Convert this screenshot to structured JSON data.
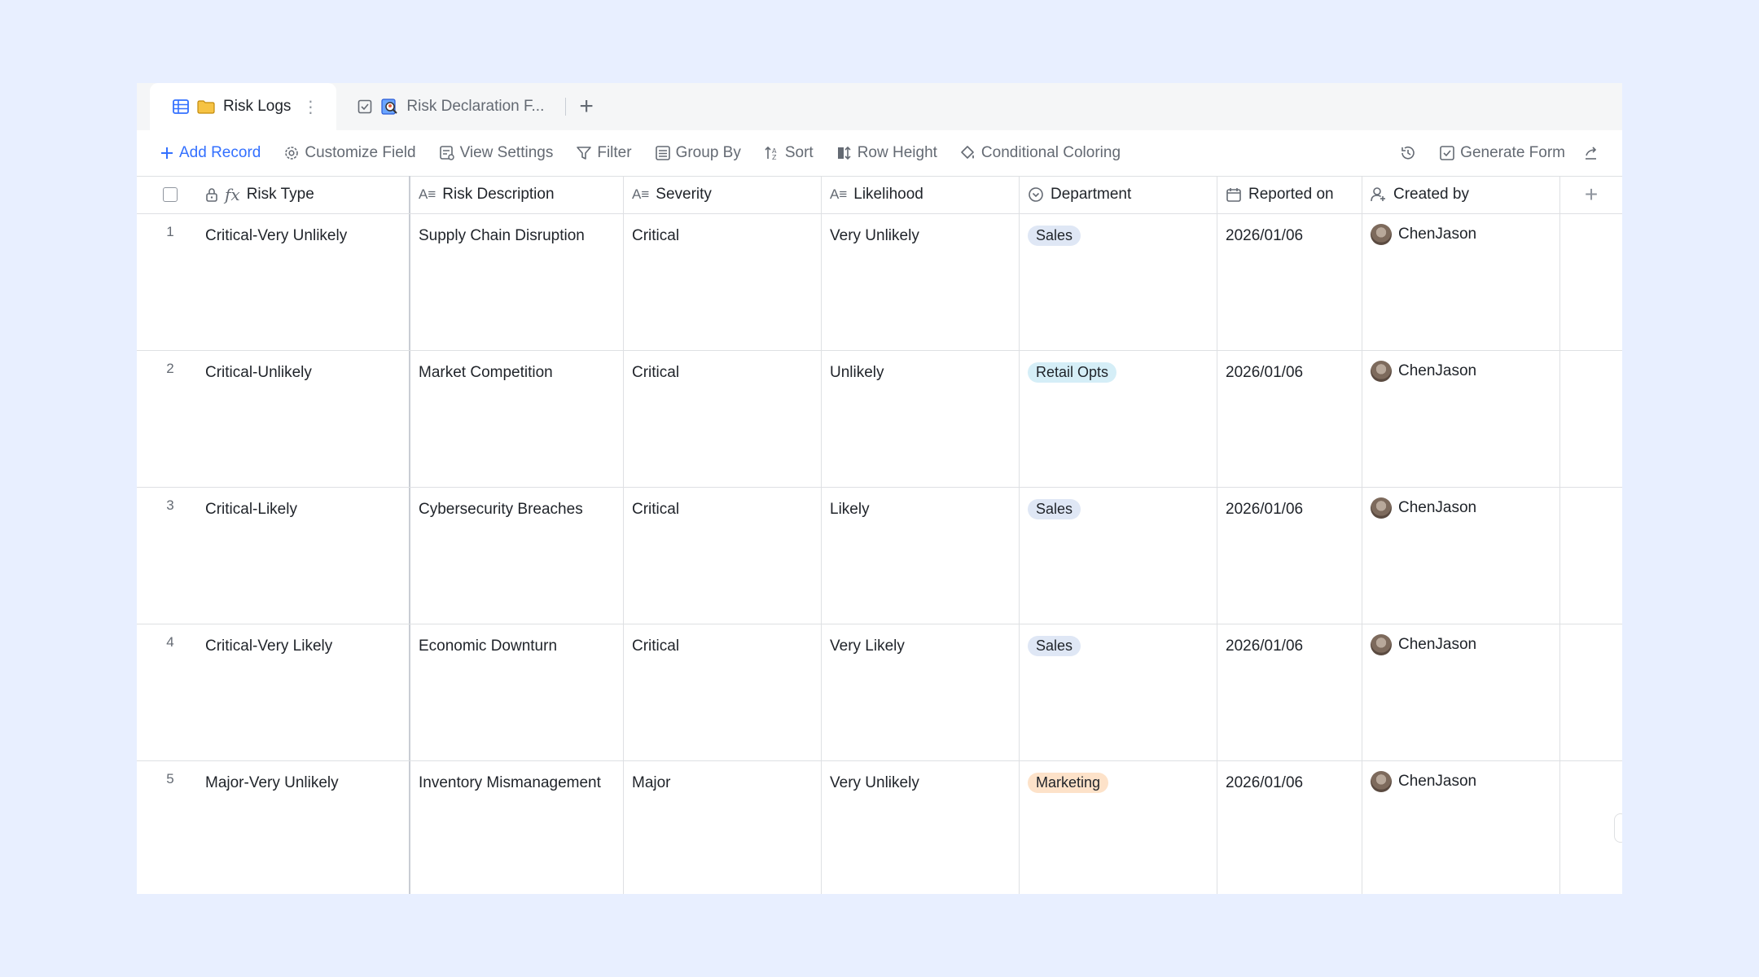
{
  "tabs": [
    {
      "label": "Risk Logs",
      "icon": "folder-icon"
    },
    {
      "label": "Risk Declaration F...",
      "icon": "form-icon"
    }
  ],
  "toolbar": {
    "add_record": "Add Record",
    "customize_field": "Customize Field",
    "view_settings": "View Settings",
    "filter": "Filter",
    "group_by": "Group By",
    "sort": "Sort",
    "row_height": "Row Height",
    "conditional_coloring": "Conditional Coloring",
    "generate_form": "Generate Form"
  },
  "columns": {
    "risk_type": "Risk Type",
    "risk_description": "Risk Description",
    "severity": "Severity",
    "likelihood": "Likelihood",
    "department": "Department",
    "reported_on": "Reported on",
    "created_by": "Created by"
  },
  "rows": [
    {
      "index": "1",
      "risk_type": "Critical-Very Unlikely",
      "risk_description": "Supply Chain Disruption",
      "severity": "Critical",
      "likelihood": "Very Unlikely",
      "department": "Sales",
      "reported_on": "2026/01/06",
      "created_by": "ChenJason"
    },
    {
      "index": "2",
      "risk_type": "Critical-Unlikely",
      "risk_description": "Market Competition",
      "severity": "Critical",
      "likelihood": "Unlikely",
      "department": "Retail Opts",
      "reported_on": "2026/01/06",
      "created_by": "ChenJason"
    },
    {
      "index": "3",
      "risk_type": "Critical-Likely",
      "risk_description": "Cybersecurity Breaches",
      "severity": "Critical",
      "likelihood": "Likely",
      "department": "Sales",
      "reported_on": "2026/01/06",
      "created_by": "ChenJason"
    },
    {
      "index": "4",
      "risk_type": "Critical-Very Likely",
      "risk_description": "Economic Downturn",
      "severity": "Critical",
      "likelihood": "Very Likely",
      "department": "Sales",
      "reported_on": "2026/01/06",
      "created_by": "ChenJason"
    },
    {
      "index": "5",
      "risk_type": "Major-Very Unlikely",
      "risk_description": "Inventory Mismanagement",
      "severity": "Major",
      "likelihood": "Very Unlikely",
      "department": "Marketing",
      "reported_on": "2026/01/06",
      "created_by": "ChenJason"
    }
  ],
  "department_colors": {
    "Sales": "#dfe7f5",
    "Retail Opts": "#d5eef7",
    "Marketing": "#fde2c9"
  },
  "colors": {
    "accent": "#3370ff",
    "background": "#e8efff"
  }
}
